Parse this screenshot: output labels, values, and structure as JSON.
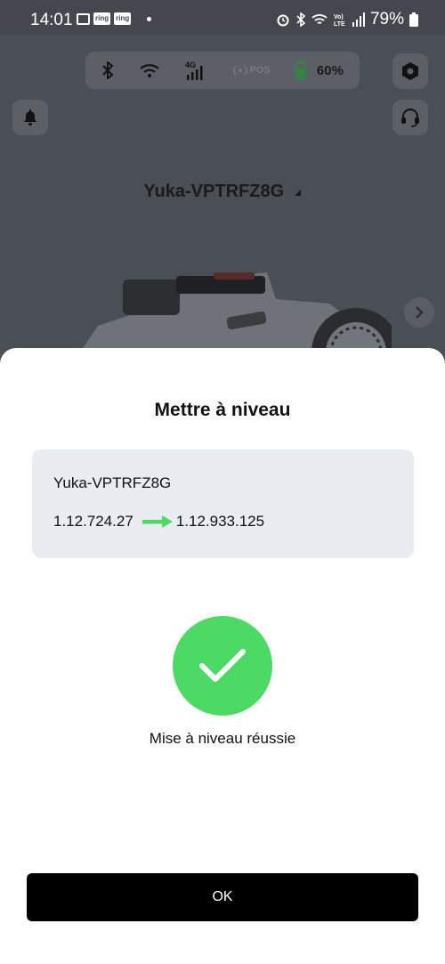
{
  "status_bar": {
    "time": "14:01",
    "notif_icons": [
      "gallery-icon",
      "ring-icon",
      "ring-icon"
    ],
    "ring_label": "ring",
    "battery_percent": "79%"
  },
  "background_app": {
    "connection": {
      "pos_label": "POS",
      "battery": "60%",
      "battery_color": "#2e8b3e"
    },
    "robot_name": "Yuka-VPTRFZ8G"
  },
  "sheet": {
    "title": "Mettre à niveau",
    "device_name": "Yuka-VPTRFZ8G",
    "current_version": "1.12.724.27",
    "new_version": "1.12.933.125",
    "arrow_color": "#4cd964",
    "success_message": "Mise à niveau réussie",
    "success_color": "#4cd964",
    "ok_label": "OK"
  }
}
